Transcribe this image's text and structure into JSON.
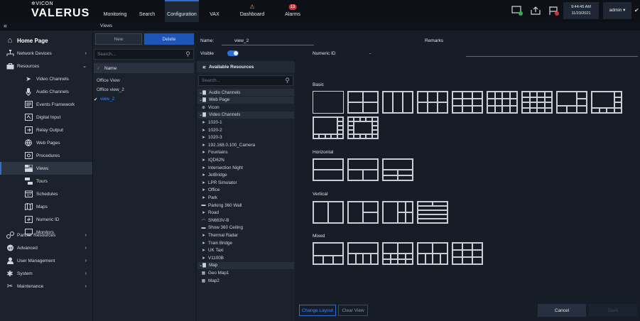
{
  "brand": {
    "small": "VICON",
    "name": "VALERUS"
  },
  "nav": [
    {
      "label": "Monitoring"
    },
    {
      "label": "Search"
    },
    {
      "label": "Configuration"
    },
    {
      "label": "VAX"
    },
    {
      "label": "Dashboard",
      "badge": "!"
    },
    {
      "label": "Alarms",
      "badge": "13"
    }
  ],
  "clock": {
    "time": "9:44:45 AM",
    "date": "11/23/2021"
  },
  "user": {
    "label": "admin"
  },
  "breadcrumb": {
    "collapse": "«",
    "title": "Views"
  },
  "sidebar": {
    "home": "Home Page",
    "items": [
      {
        "label": "Network Devices",
        "arrow": "›"
      },
      {
        "label": "Resources",
        "arrow": "⌄"
      },
      {
        "label": "Video Channels"
      },
      {
        "label": "Audio Channels"
      },
      {
        "label": "Events Framework"
      },
      {
        "label": "Digital Input"
      },
      {
        "label": "Relay Output"
      },
      {
        "label": "Web Pages"
      },
      {
        "label": "Procedures"
      },
      {
        "label": "Views"
      },
      {
        "label": "Tours"
      },
      {
        "label": "Schedules"
      },
      {
        "label": "Maps"
      },
      {
        "label": "Numeric ID"
      },
      {
        "label": "Monitors"
      },
      {
        "label": "Partner Resources",
        "arrow": "›"
      },
      {
        "label": "Advanced",
        "arrow": "›"
      },
      {
        "label": "User Management",
        "arrow": "›"
      },
      {
        "label": "System",
        "arrow": "›"
      },
      {
        "label": "Maintenance",
        "arrow": "›"
      }
    ]
  },
  "views_panel": {
    "new_label": "New",
    "delete_label": "Delete",
    "search_placeholder": "Search...",
    "column": "Name",
    "items": [
      "Office View",
      "Office view_2",
      "view_2"
    ]
  },
  "form": {
    "name_label": "Name:",
    "name_value": "view_2",
    "remarks_label": "Remarks",
    "visible_label": "Visible",
    "numeric_label": "Numeric ID",
    "numeric_value": "-"
  },
  "resources": {
    "title": "Available Resources",
    "collapse": "«",
    "search_placeholder": "Search...",
    "items": [
      {
        "label": "Audio Channels",
        "group": true
      },
      {
        "label": "Web Page",
        "group": true
      },
      {
        "label": "Vicon",
        "icon": "globe"
      },
      {
        "label": "Video Channels",
        "group": true
      },
      {
        "label": "1020-1",
        "icon": "cam"
      },
      {
        "label": "1020-2",
        "icon": "cam"
      },
      {
        "label": "1020-3",
        "icon": "cam"
      },
      {
        "label": "192.168.0.100_Camera",
        "icon": "cam"
      },
      {
        "label": "Fountains",
        "icon": "cam"
      },
      {
        "label": "IQD62N",
        "icon": "cam"
      },
      {
        "label": "Intersection Night",
        "icon": "cam"
      },
      {
        "label": "JetBridge",
        "icon": "cam"
      },
      {
        "label": "LPR Simulator",
        "icon": "cam"
      },
      {
        "label": "Office",
        "icon": "cam"
      },
      {
        "label": "Park",
        "icon": "cam"
      },
      {
        "label": "Parking 360 Wall",
        "icon": "pano"
      },
      {
        "label": "Road",
        "icon": "cam"
      },
      {
        "label": "SN663V-B",
        "icon": "dome"
      },
      {
        "label": "Show 360 Ceiling",
        "icon": "pano"
      },
      {
        "label": "Thermal Radar",
        "icon": "cam"
      },
      {
        "label": "Train Bridge",
        "icon": "cam"
      },
      {
        "label": "UK Taxi",
        "icon": "cam"
      },
      {
        "label": "V1100B",
        "icon": "cam"
      },
      {
        "label": "Map",
        "group": true
      },
      {
        "label": "Geo Map1",
        "icon": "map"
      },
      {
        "label": "Map2",
        "icon": "map"
      }
    ]
  },
  "layouts": {
    "basic": "Basic",
    "horizontal": "Horizontal",
    "vertical": "Vertical",
    "mixed": "Mixed"
  },
  "footer": {
    "change_layout": "Change Layout",
    "clear_view": "Clear View",
    "cancel": "Cancel",
    "save": "Save"
  }
}
